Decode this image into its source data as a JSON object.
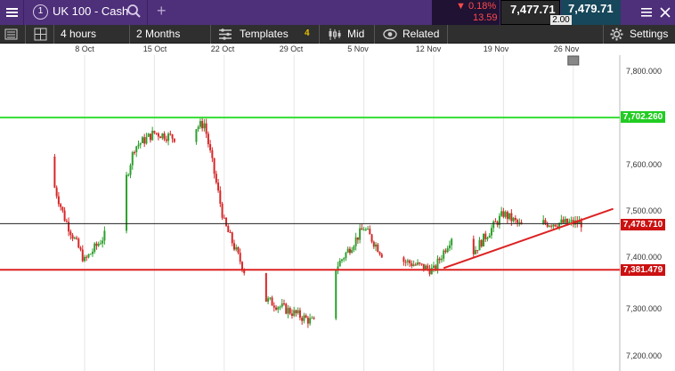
{
  "header": {
    "tab_number": "1",
    "instrument": "UK 100 - Cash",
    "change_pct": "▼ 0.18%",
    "change_pts": "13.59",
    "sell_price": "7,477.71",
    "buy_price": "7,479.71",
    "spread": "2.00"
  },
  "toolbar": {
    "interval": "4 hours",
    "range": "2 Months",
    "templates": "Templates",
    "templates_count": "4",
    "price_type": "Mid",
    "related": "Related",
    "settings": "Settings"
  },
  "icons": {
    "menu": "hamburger-icon",
    "search": "search-icon",
    "add_tab": "plus-icon",
    "window_menu": "hamburger-icon",
    "close": "close-icon",
    "layout": "layout-grid-icon",
    "candles": "candles-icon",
    "related": "eye-icon",
    "settings": "gear-icon"
  },
  "colors": {
    "header_bg": "#4e2f7a",
    "toolbar_bg": "#2f2f2f",
    "up": "#2ca02c",
    "down": "#d62728",
    "resistance": "#33dd33",
    "support": "#dd2222"
  },
  "chart_data": {
    "type": "candlestick",
    "x_ticks": [
      "8 Oct",
      "15 Oct",
      "22 Oct",
      "29 Oct",
      "5 Nov",
      "12 Nov",
      "19 Nov",
      "26 Nov"
    ],
    "y_ticks": [
      "7,800.000",
      "7,700.000",
      "7,600.000",
      "7,500.000",
      "7,400.000",
      "7,300.000",
      "7,200.000"
    ],
    "ylim": [
      7200,
      7800
    ],
    "current_price": "7,478.710",
    "horizontal_levels": [
      {
        "label": "7,702.260",
        "value": 7702.26,
        "color": "#33dd33"
      },
      {
        "label": "7,381.479",
        "value": 7381.479,
        "color": "#dd2222"
      }
    ],
    "trendline": {
      "x": [
        "13 Nov",
        "30 Nov"
      ],
      "y": [
        7385,
        7510
      ]
    },
    "close_path_approx": {
      "x": [
        "4 Oct",
        "6 Oct",
        "8 Oct",
        "11 Oct",
        "13 Oct",
        "15 Oct",
        "17 Oct",
        "20 Oct",
        "22 Oct",
        "24 Oct",
        "26 Oct",
        "29 Oct",
        "31 Oct",
        "2 Nov",
        "5 Nov",
        "7 Nov",
        "9 Nov",
        "12 Nov",
        "14 Nov",
        "16 Nov",
        "19 Nov",
        "21 Nov",
        "23 Nov",
        "26 Nov"
      ],
      "y": [
        7620,
        7490,
        7400,
        7480,
        7640,
        7670,
        7660,
        7690,
        7480,
        7380,
        7320,
        7290,
        7270,
        7380,
        7470,
        7410,
        7400,
        7380,
        7460,
        7420,
        7500,
        7470,
        7480,
        7480
      ]
    }
  }
}
